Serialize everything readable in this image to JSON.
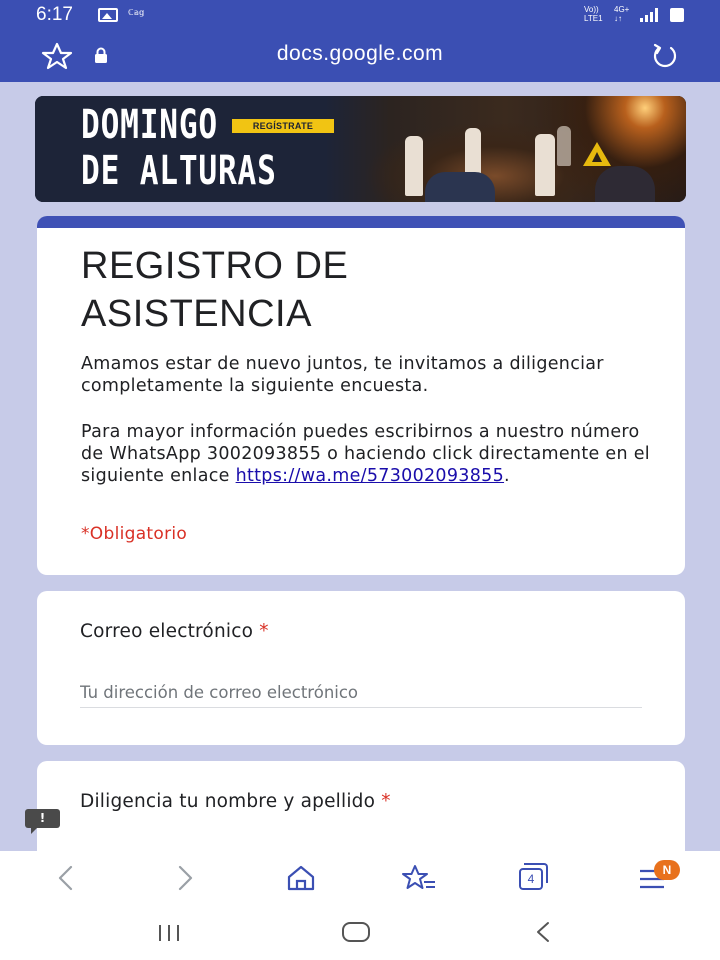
{
  "status_bar": {
    "time": "6:17",
    "small_label": "ℂ𝕒𝕘",
    "network_line1": "Vo))",
    "network_line2": "LTE1",
    "network2_line1": "4G+",
    "network2_line2": "↓↑"
  },
  "browser": {
    "url": "docs.google.com",
    "star_icon": "star-outline-icon",
    "lock_icon": "lock-icon",
    "reload_icon": "reload-icon"
  },
  "banner": {
    "title_line1": "DOMINGO",
    "title_line2": "DE ALTURAS",
    "badge": "REGÍSTRATE"
  },
  "form": {
    "accent_color": "#3f51b5",
    "title_line1": "REGISTRO DE",
    "title_line2": "ASISTENCIA",
    "description_p1": "Amamos estar de nuevo juntos, te invitamos a diligenciar completamente la siguiente encuesta.",
    "description_p2_prefix": "Para mayor información puedes escribirnos a nuestro número de WhatsApp 3002093855 o haciendo click directamente en el siguiente enlace ",
    "description_link": "https://wa.me/573002093855",
    "description_p2_suffix": ".",
    "required_note": "*Obligatorio"
  },
  "questions": [
    {
      "label": "Correo electrónico",
      "required_mark": "*",
      "placeholder": "Tu dirección de correo electrónico"
    },
    {
      "label": "Diligencia tu nombre y apellido",
      "required_mark": "*"
    }
  ],
  "feedback": {
    "label": "!"
  },
  "toolbar": {
    "tabs_count": "4",
    "menu_badge": "N",
    "brand_color": "#3b4fb3"
  }
}
